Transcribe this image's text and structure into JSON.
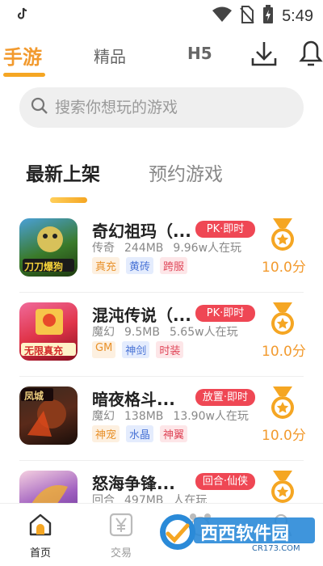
{
  "status_bar": {
    "time": "5:49",
    "app_icon": "tiktok-icon"
  },
  "top_tabs": {
    "items": [
      "手游",
      "精品",
      "H5"
    ],
    "active": "手游"
  },
  "search": {
    "placeholder": "搜索你想玩的游戏"
  },
  "sub_tabs": {
    "items": [
      "最新上架",
      "预约游戏"
    ],
    "active": "最新上架"
  },
  "games": [
    {
      "name": "奇幻祖玛（...",
      "badge": "PK·即时",
      "genre": "传奇",
      "size": "244MB",
      "players": "9.96w人在玩",
      "tags": [
        "真充",
        "黄砖",
        "跨服"
      ],
      "score": "10.0分",
      "thumb_text": "刀刀爆狗"
    },
    {
      "name": "混沌传说（...",
      "badge": "PK·即时",
      "genre": "魔幻",
      "size": "9.5MB",
      "players": "5.65w人在玩",
      "tags": [
        "GM",
        "神剑",
        "时装"
      ],
      "score": "10.0分",
      "thumb_text": "无限真充"
    },
    {
      "name": "暗夜格斗...",
      "badge": "放置·即时",
      "genre": "魔幻",
      "size": "138MB",
      "players": "13.90w人在玩",
      "tags": [
        "神宠",
        "水晶",
        "神翼"
      ],
      "score": "10.0分",
      "thumb_text": "凤城"
    },
    {
      "name": "怒海争锋...",
      "badge": "回合·仙侠",
      "genre": "回合",
      "size": "497MB",
      "players": "人在玩",
      "tags": [],
      "score": "",
      "thumb_text": ""
    }
  ],
  "bottom_nav": {
    "items": [
      "首页",
      "交易",
      "",
      ""
    ],
    "active": "首页"
  },
  "watermark": {
    "text": "西西软件园",
    "sub": "CR173.COM"
  },
  "colors": {
    "accent": "#f29a2e",
    "badge": "#ef4754",
    "search_bg": "#efefef"
  }
}
